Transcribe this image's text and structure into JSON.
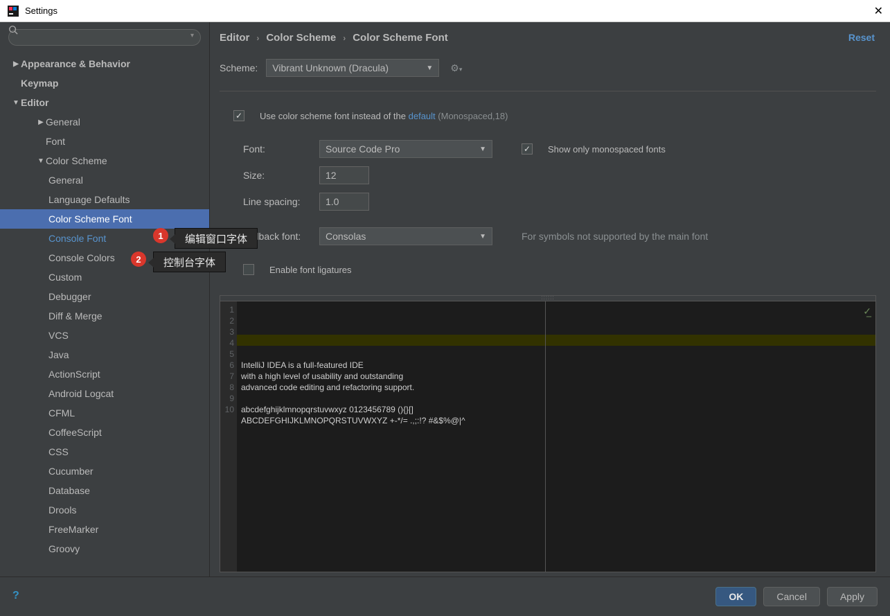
{
  "window_title": "Settings",
  "sidebar": {
    "items": [
      {
        "label": "Appearance & Behavior",
        "indent": 0,
        "arrow": "▶",
        "bold": true
      },
      {
        "label": "Keymap",
        "indent": 0,
        "arrow": "",
        "bold": true
      },
      {
        "label": "Editor",
        "indent": 0,
        "arrow": "▼",
        "bold": true
      },
      {
        "label": "General",
        "indent": 1,
        "arrow": "▶"
      },
      {
        "label": "Font",
        "indent": 1,
        "arrow": ""
      },
      {
        "label": "Color Scheme",
        "indent": 1,
        "arrow": "▼"
      },
      {
        "label": "General",
        "indent": 2,
        "arrow": ""
      },
      {
        "label": "Language Defaults",
        "indent": 2,
        "arrow": ""
      },
      {
        "label": "Color Scheme Font",
        "indent": 2,
        "arrow": "",
        "selected": true
      },
      {
        "label": "Console Font",
        "indent": 2,
        "arrow": "",
        "link": true
      },
      {
        "label": "Console Colors",
        "indent": 2,
        "arrow": ""
      },
      {
        "label": "Custom",
        "indent": 2,
        "arrow": ""
      },
      {
        "label": "Debugger",
        "indent": 2,
        "arrow": ""
      },
      {
        "label": "Diff & Merge",
        "indent": 2,
        "arrow": ""
      },
      {
        "label": "VCS",
        "indent": 2,
        "arrow": ""
      },
      {
        "label": "Java",
        "indent": 2,
        "arrow": ""
      },
      {
        "label": "ActionScript",
        "indent": 2,
        "arrow": ""
      },
      {
        "label": "Android Logcat",
        "indent": 2,
        "arrow": ""
      },
      {
        "label": "CFML",
        "indent": 2,
        "arrow": ""
      },
      {
        "label": "CoffeeScript",
        "indent": 2,
        "arrow": ""
      },
      {
        "label": "CSS",
        "indent": 2,
        "arrow": ""
      },
      {
        "label": "Cucumber",
        "indent": 2,
        "arrow": ""
      },
      {
        "label": "Database",
        "indent": 2,
        "arrow": ""
      },
      {
        "label": "Drools",
        "indent": 2,
        "arrow": ""
      },
      {
        "label": "FreeMarker",
        "indent": 2,
        "arrow": ""
      },
      {
        "label": "Groovy",
        "indent": 2,
        "arrow": ""
      }
    ]
  },
  "breadcrumb": [
    "Editor",
    "Color Scheme",
    "Color Scheme Font"
  ],
  "reset_label": "Reset",
  "scheme_label": "Scheme:",
  "scheme_value": "Vibrant Unknown (Dracula)",
  "use_scheme_font_label_pre": "Use color scheme font instead of the ",
  "use_scheme_font_link": "default",
  "use_scheme_font_suffix": " (Monospaced,18)",
  "font_label": "Font:",
  "font_value": "Source Code Pro",
  "show_monospaced_label": "Show only monospaced fonts",
  "size_label": "Size:",
  "size_value": "12",
  "line_spacing_label": "Line spacing:",
  "line_spacing_value": "1.0",
  "fallback_label": "Fallback font:",
  "fallback_value": "Consolas",
  "fallback_hint": "For symbols not supported by the main font",
  "ligatures_label": "Enable font ligatures",
  "preview_lines": [
    "IntelliJ IDEA is a full-featured IDE",
    "with a high level of usability and outstanding",
    "advanced code editing and refactoring support.",
    "",
    "abcdefghijklmnopqrstuvwxyz 0123456789 (){}[]",
    "ABCDEFGHIJKLMNOPQRSTUVWXYZ +-*/= .,;:!? #&$%@|^",
    "",
    "",
    "",
    ""
  ],
  "callouts": {
    "1": "编辑窗口字体",
    "2": "控制台字体"
  },
  "footer": {
    "ok": "OK",
    "cancel": "Cancel",
    "apply": "Apply"
  }
}
